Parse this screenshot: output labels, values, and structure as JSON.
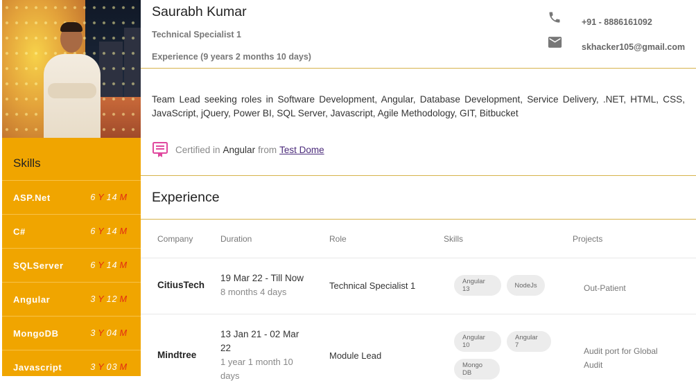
{
  "profile": {
    "name": "Saurabh Kumar",
    "title": "Technical Specialist 1",
    "experience_total": "Experience (9 years 2 months 10 days)",
    "phone": "+91 - 8886161092",
    "email": "skhacker105@gmail.com"
  },
  "summary": "Team Lead seeking roles in Software Development, Angular, Database Development, Service Delivery, .NET, HTML, CSS, JavaScript, jQuery, Power BI, SQL Server, Javascript, Agile Methodology, GIT, Bitbucket",
  "certification": {
    "prefix": "Certified in",
    "subject": "Angular",
    "from_word": "from",
    "issuer": "Test Dome"
  },
  "sidebar": {
    "skills_title": "Skills",
    "skills": [
      {
        "name": "ASP.Net",
        "years": "6",
        "year_unit": "Y",
        "months": "14",
        "month_unit": "M"
      },
      {
        "name": "C#",
        "years": "6",
        "year_unit": "Y",
        "months": "14",
        "month_unit": "M"
      },
      {
        "name": "SQLServer",
        "years": "6",
        "year_unit": "Y",
        "months": "14",
        "month_unit": "M"
      },
      {
        "name": "Angular",
        "years": "3",
        "year_unit": "Y",
        "months": "12",
        "month_unit": "M"
      },
      {
        "name": "MongoDB",
        "years": "3",
        "year_unit": "Y",
        "months": "04",
        "month_unit": "M"
      },
      {
        "name": "Javascript",
        "years": "3",
        "year_unit": "Y",
        "months": "03",
        "month_unit": "M"
      }
    ]
  },
  "experience": {
    "heading": "Experience",
    "columns": [
      "Company",
      "Duration",
      "Role",
      "Skills",
      "Projects"
    ],
    "rows": [
      {
        "company": "CitiusTech",
        "dates": "19 Mar 22 - Till Now",
        "length": "8 months 4 days",
        "role": "Technical Specialist 1",
        "skills": [
          "Angular 13",
          "NodeJs"
        ],
        "projects": "Out-Patient"
      },
      {
        "company": "Mindtree",
        "dates": "13 Jan 21 - 02 Mar 22",
        "length": "1 year 1 month 10 days",
        "role": "Module Lead",
        "skills": [
          "Angular 10",
          "Angular 7",
          "Mongo DB"
        ],
        "projects": "Audit port for Global Audit"
      }
    ]
  },
  "colors": {
    "sidebar_bg": "#f0a500",
    "accent_rule": "#d6b24a",
    "unit_red": "#e22a14",
    "link": "#4a2a7a",
    "cert_icon": "#e0479e"
  },
  "icons": {
    "phone": "phone-icon",
    "email": "email-icon",
    "certificate": "certificate-icon"
  }
}
